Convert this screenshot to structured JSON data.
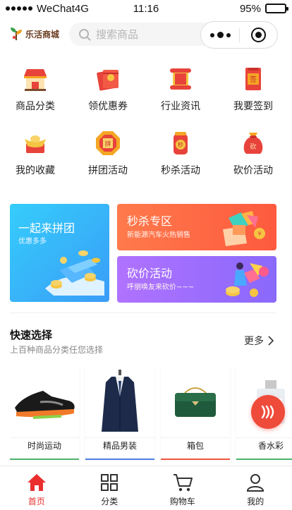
{
  "status_bar": {
    "carrier": "WeChat4G",
    "time": "11:16",
    "battery": "95%",
    "battery_level": 0.95,
    "signal_bars": 5
  },
  "header": {
    "logo_text": "乐活商城",
    "search_placeholder": "搜索商品",
    "capsule_icons": [
      "more-dots-icon",
      "close-target-icon"
    ]
  },
  "nav_grid": [
    {
      "label": "商品分类",
      "icon": "shop-icon"
    },
    {
      "label": "领优惠券",
      "icon": "coupon-icon"
    },
    {
      "label": "行业资讯",
      "icon": "scroll-icon"
    },
    {
      "label": "我要签到",
      "icon": "sign-in-icon"
    },
    {
      "label": "我的收藏",
      "icon": "gold-ingot-icon"
    },
    {
      "label": "拼团活动",
      "icon": "group-buy-icon"
    },
    {
      "label": "秒杀活动",
      "icon": "seckill-icon"
    },
    {
      "label": "砍价活动",
      "icon": "bargain-bag-icon"
    }
  ],
  "promos": {
    "group": {
      "title": "一起来拼团",
      "subtitle": "优惠多多"
    },
    "seckill": {
      "title": "秒杀专区",
      "subtitle": "新能源汽车火热销售"
    },
    "bargain": {
      "title": "砍价活动",
      "subtitle": "呼朋唤友来砍价~~~"
    }
  },
  "quick_select": {
    "title": "快速选择",
    "subtitle": "上百种商品分类任您选择",
    "more_label": "更多",
    "items": [
      {
        "label": "时尚运动",
        "accent": "#4cb46b"
      },
      {
        "label": "精品男装",
        "accent": "#4a7fe0"
      },
      {
        "label": "箱包",
        "accent": "#f05540"
      },
      {
        "label": "香水彩",
        "accent": "#4cb46b"
      }
    ]
  },
  "tabbar": [
    {
      "label": "首页",
      "icon": "home-icon",
      "active": true
    },
    {
      "label": "分类",
      "icon": "category-grid-icon",
      "active": false
    },
    {
      "label": "购物车",
      "icon": "cart-icon",
      "active": false
    },
    {
      "label": "我的",
      "icon": "user-icon",
      "active": false
    }
  ],
  "colors": {
    "accent": "#ea2e2e",
    "fab": "#ef4b3a"
  }
}
